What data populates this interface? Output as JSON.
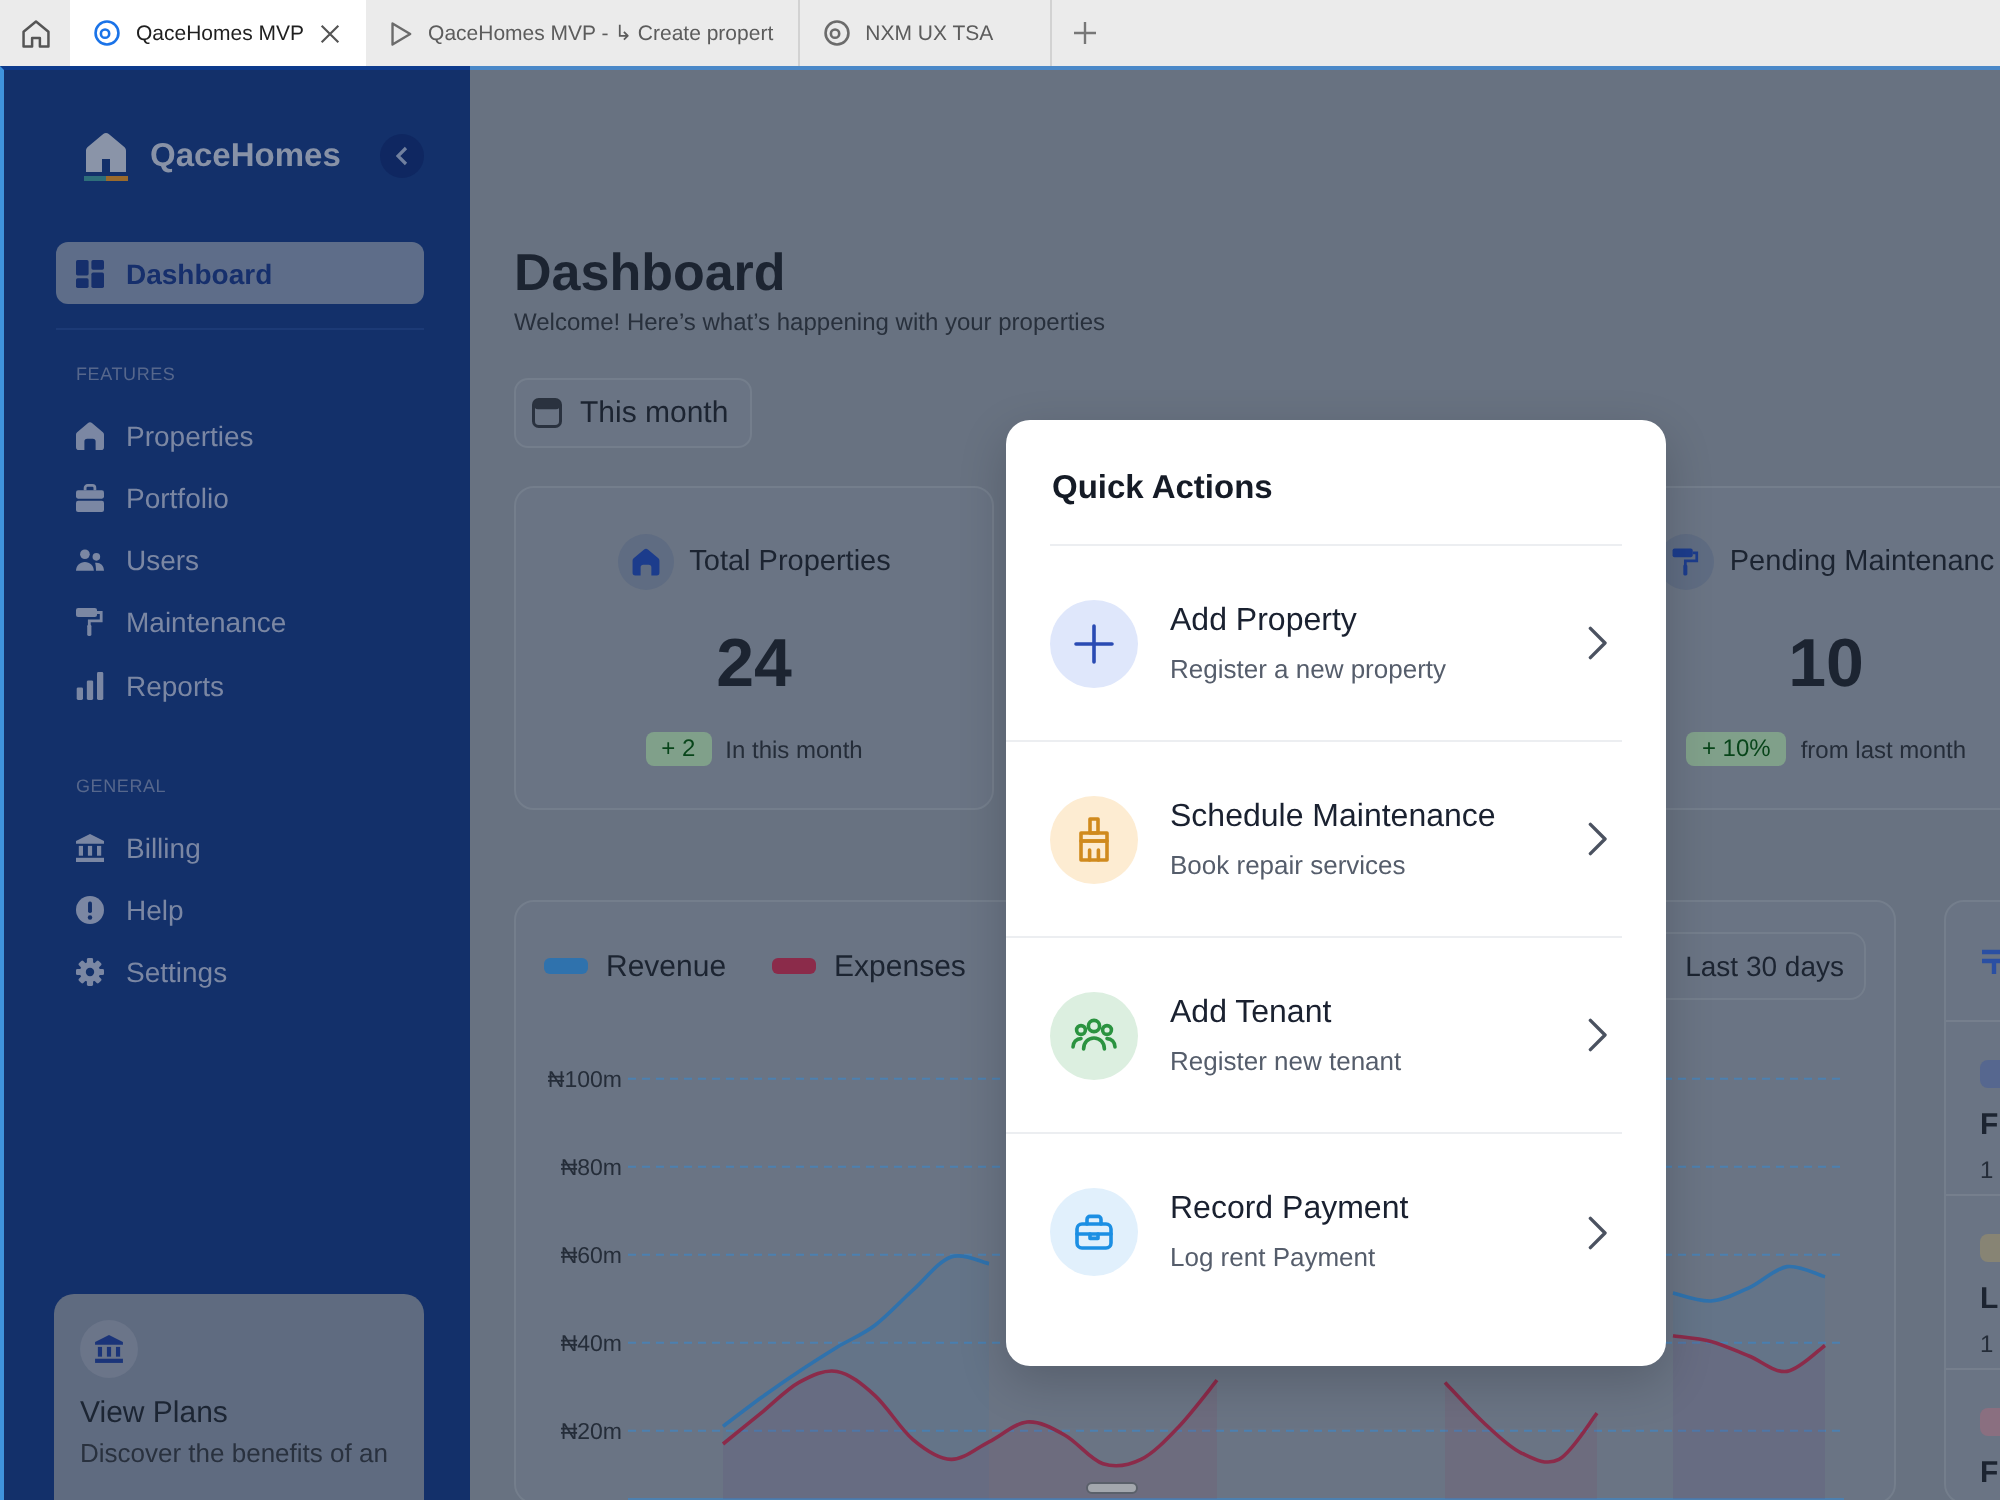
{
  "browser": {
    "tabs": [
      {
        "kind": "app",
        "label": "QaceHomes MVP",
        "selected": true
      },
      {
        "kind": "media",
        "label": "QaceHomes MVP - ↳ Create propert",
        "selected": false
      },
      {
        "kind": "app",
        "label": "NXM UX TSA",
        "selected": false
      }
    ]
  },
  "sidebar": {
    "brand": "QaceHomes",
    "nav": [
      {
        "label": "Dashboard",
        "selected": true
      }
    ],
    "sections": [
      {
        "heading": "FEATURES",
        "items": [
          {
            "label": "Properties",
            "selected": false
          },
          {
            "label": "Portfolio",
            "selected": false
          },
          {
            "label": "Users",
            "selected": false
          },
          {
            "label": "Maintenance",
            "selected": false
          },
          {
            "label": "Reports",
            "selected": false
          }
        ]
      },
      {
        "heading": "GENERAL",
        "items": [
          {
            "label": "Billing",
            "selected": false
          },
          {
            "label": "Help",
            "selected": false
          },
          {
            "label": "Settings",
            "selected": false
          }
        ]
      }
    ],
    "plan_card": {
      "title": "View Plans",
      "text": "Discover the benefits of an"
    }
  },
  "header": {
    "title": "Dashboard",
    "subtitle": "Welcome! Here’s what’s happening with your properties",
    "period_button": "This month"
  },
  "stats": [
    {
      "kind": "properties",
      "title": "Total Properties",
      "value": "24",
      "change": "+ 2",
      "note": "In this month"
    },
    {
      "kind": "maintenance",
      "title": "Pending Maintenanc",
      "value": "10",
      "change": "+ 10%",
      "note": "from last month"
    }
  ],
  "chart": {
    "range_button": "Last 30 days",
    "chart_data": {
      "type": "area",
      "grid": true,
      "ylim": [
        4.5,
        100
      ],
      "yticks": [
        {
          "value": 100,
          "label": "₦100m"
        },
        {
          "value": 80,
          "label": "₦80m"
        },
        {
          "value": 60,
          "label": "₦60m"
        },
        {
          "value": 40,
          "label": "₦40m"
        },
        {
          "value": 20,
          "label": "₦20m"
        }
      ],
      "series": [
        {
          "name": "Revenue",
          "color": "#2f72ad",
          "values": [
            null,
            null,
            21,
            27.5,
            33.5,
            39,
            44,
            52,
            59.5,
            58,
            null,
            null,
            null,
            null,
            null,
            null,
            null,
            null,
            null,
            null,
            null,
            null,
            null,
            null,
            null,
            null,
            null,
            51.3,
            49.5,
            52.5,
            57.3,
            55
          ]
        },
        {
          "name": "Expenses",
          "color": "#8b2b4a",
          "values": [
            null,
            null,
            17,
            24,
            31,
            33.5,
            28,
            18,
            13.5,
            17.5,
            22,
            19,
            12.5,
            13.5,
            21,
            31.5,
            null,
            null,
            null,
            null,
            null,
            31,
            22,
            15,
            13.5,
            24,
            null,
            41.6,
            40.3,
            37,
            33.5,
            39.4
          ]
        }
      ]
    }
  },
  "side_card": {
    "items": [
      {
        "title": "F",
        "detail": "1",
        "color": "#56678f"
      },
      {
        "title": "L",
        "detail": "1",
        "color": "#878474"
      },
      {
        "title": "F",
        "color": "#8a6f80"
      }
    ]
  },
  "quick_actions": {
    "title": "Quick Actions",
    "items": [
      {
        "kind": "property",
        "title": "Add Property",
        "subtitle": "Register a new property"
      },
      {
        "kind": "maintenance",
        "title": "Schedule Maintenance",
        "subtitle": "Book repair services"
      },
      {
        "kind": "tenant",
        "title": "Add Tenant",
        "subtitle": "Register new tenant"
      },
      {
        "kind": "payment",
        "title": "Record Payment",
        "subtitle": "Log rent Payment"
      }
    ]
  }
}
